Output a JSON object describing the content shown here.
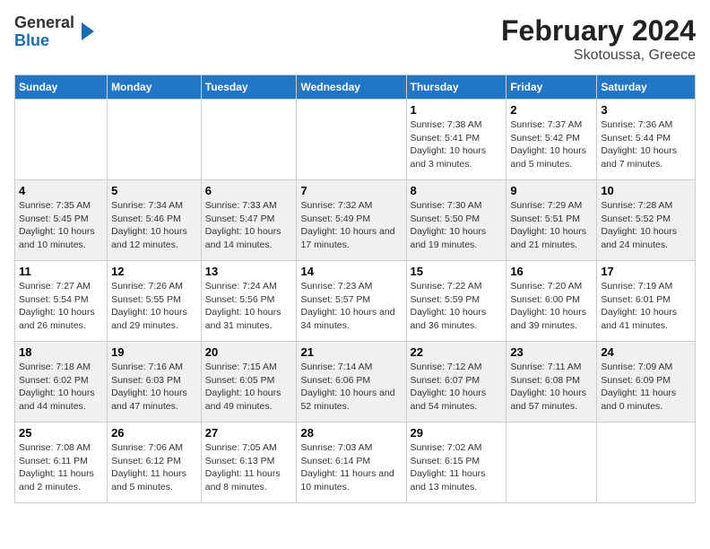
{
  "header": {
    "logo_line1": "General",
    "logo_line2": "Blue",
    "title": "February 2024",
    "subtitle": "Skotoussa, Greece"
  },
  "days_of_week": [
    "Sunday",
    "Monday",
    "Tuesday",
    "Wednesday",
    "Thursday",
    "Friday",
    "Saturday"
  ],
  "weeks": [
    [
      {
        "day": "",
        "info": ""
      },
      {
        "day": "",
        "info": ""
      },
      {
        "day": "",
        "info": ""
      },
      {
        "day": "",
        "info": ""
      },
      {
        "day": "1",
        "info": "Sunrise: 7:38 AM\nSunset: 5:41 PM\nDaylight: 10 hours\nand 3 minutes."
      },
      {
        "day": "2",
        "info": "Sunrise: 7:37 AM\nSunset: 5:42 PM\nDaylight: 10 hours\nand 5 minutes."
      },
      {
        "day": "3",
        "info": "Sunrise: 7:36 AM\nSunset: 5:44 PM\nDaylight: 10 hours\nand 7 minutes."
      }
    ],
    [
      {
        "day": "4",
        "info": "Sunrise: 7:35 AM\nSunset: 5:45 PM\nDaylight: 10 hours\nand 10 minutes."
      },
      {
        "day": "5",
        "info": "Sunrise: 7:34 AM\nSunset: 5:46 PM\nDaylight: 10 hours\nand 12 minutes."
      },
      {
        "day": "6",
        "info": "Sunrise: 7:33 AM\nSunset: 5:47 PM\nDaylight: 10 hours\nand 14 minutes."
      },
      {
        "day": "7",
        "info": "Sunrise: 7:32 AM\nSunset: 5:49 PM\nDaylight: 10 hours\nand 17 minutes."
      },
      {
        "day": "8",
        "info": "Sunrise: 7:30 AM\nSunset: 5:50 PM\nDaylight: 10 hours\nand 19 minutes."
      },
      {
        "day": "9",
        "info": "Sunrise: 7:29 AM\nSunset: 5:51 PM\nDaylight: 10 hours\nand 21 minutes."
      },
      {
        "day": "10",
        "info": "Sunrise: 7:28 AM\nSunset: 5:52 PM\nDaylight: 10 hours\nand 24 minutes."
      }
    ],
    [
      {
        "day": "11",
        "info": "Sunrise: 7:27 AM\nSunset: 5:54 PM\nDaylight: 10 hours\nand 26 minutes."
      },
      {
        "day": "12",
        "info": "Sunrise: 7:26 AM\nSunset: 5:55 PM\nDaylight: 10 hours\nand 29 minutes."
      },
      {
        "day": "13",
        "info": "Sunrise: 7:24 AM\nSunset: 5:56 PM\nDaylight: 10 hours\nand 31 minutes."
      },
      {
        "day": "14",
        "info": "Sunrise: 7:23 AM\nSunset: 5:57 PM\nDaylight: 10 hours\nand 34 minutes."
      },
      {
        "day": "15",
        "info": "Sunrise: 7:22 AM\nSunset: 5:59 PM\nDaylight: 10 hours\nand 36 minutes."
      },
      {
        "day": "16",
        "info": "Sunrise: 7:20 AM\nSunset: 6:00 PM\nDaylight: 10 hours\nand 39 minutes."
      },
      {
        "day": "17",
        "info": "Sunrise: 7:19 AM\nSunset: 6:01 PM\nDaylight: 10 hours\nand 41 minutes."
      }
    ],
    [
      {
        "day": "18",
        "info": "Sunrise: 7:18 AM\nSunset: 6:02 PM\nDaylight: 10 hours\nand 44 minutes."
      },
      {
        "day": "19",
        "info": "Sunrise: 7:16 AM\nSunset: 6:03 PM\nDaylight: 10 hours\nand 47 minutes."
      },
      {
        "day": "20",
        "info": "Sunrise: 7:15 AM\nSunset: 6:05 PM\nDaylight: 10 hours\nand 49 minutes."
      },
      {
        "day": "21",
        "info": "Sunrise: 7:14 AM\nSunset: 6:06 PM\nDaylight: 10 hours\nand 52 minutes."
      },
      {
        "day": "22",
        "info": "Sunrise: 7:12 AM\nSunset: 6:07 PM\nDaylight: 10 hours\nand 54 minutes."
      },
      {
        "day": "23",
        "info": "Sunrise: 7:11 AM\nSunset: 6:08 PM\nDaylight: 10 hours\nand 57 minutes."
      },
      {
        "day": "24",
        "info": "Sunrise: 7:09 AM\nSunset: 6:09 PM\nDaylight: 11 hours\nand 0 minutes."
      }
    ],
    [
      {
        "day": "25",
        "info": "Sunrise: 7:08 AM\nSunset: 6:11 PM\nDaylight: 11 hours\nand 2 minutes."
      },
      {
        "day": "26",
        "info": "Sunrise: 7:06 AM\nSunset: 6:12 PM\nDaylight: 11 hours\nand 5 minutes."
      },
      {
        "day": "27",
        "info": "Sunrise: 7:05 AM\nSunset: 6:13 PM\nDaylight: 11 hours\nand 8 minutes."
      },
      {
        "day": "28",
        "info": "Sunrise: 7:03 AM\nSunset: 6:14 PM\nDaylight: 11 hours\nand 10 minutes."
      },
      {
        "day": "29",
        "info": "Sunrise: 7:02 AM\nSunset: 6:15 PM\nDaylight: 11 hours\nand 13 minutes."
      },
      {
        "day": "",
        "info": ""
      },
      {
        "day": "",
        "info": ""
      }
    ]
  ]
}
